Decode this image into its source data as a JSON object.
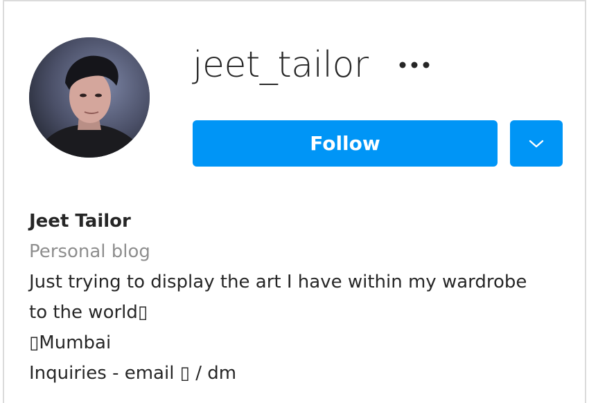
{
  "profile": {
    "username": "jeet_tailor",
    "full_name": "Jeet Tailor",
    "category": "Personal blog",
    "bio_lines": [
      "Just trying to display the art I have within my wardrobe",
      "to the world▯",
      "▯Mumbai",
      "Inquiries - email ▯ / dm"
    ]
  },
  "actions": {
    "follow_label": "Follow",
    "more_icon": "more-horizontal-icon",
    "dropdown_icon": "chevron-down-icon"
  },
  "colors": {
    "accent": "#0095f6",
    "text": "#262626",
    "muted": "#8e8e8e",
    "border": "#dbdbdb"
  }
}
